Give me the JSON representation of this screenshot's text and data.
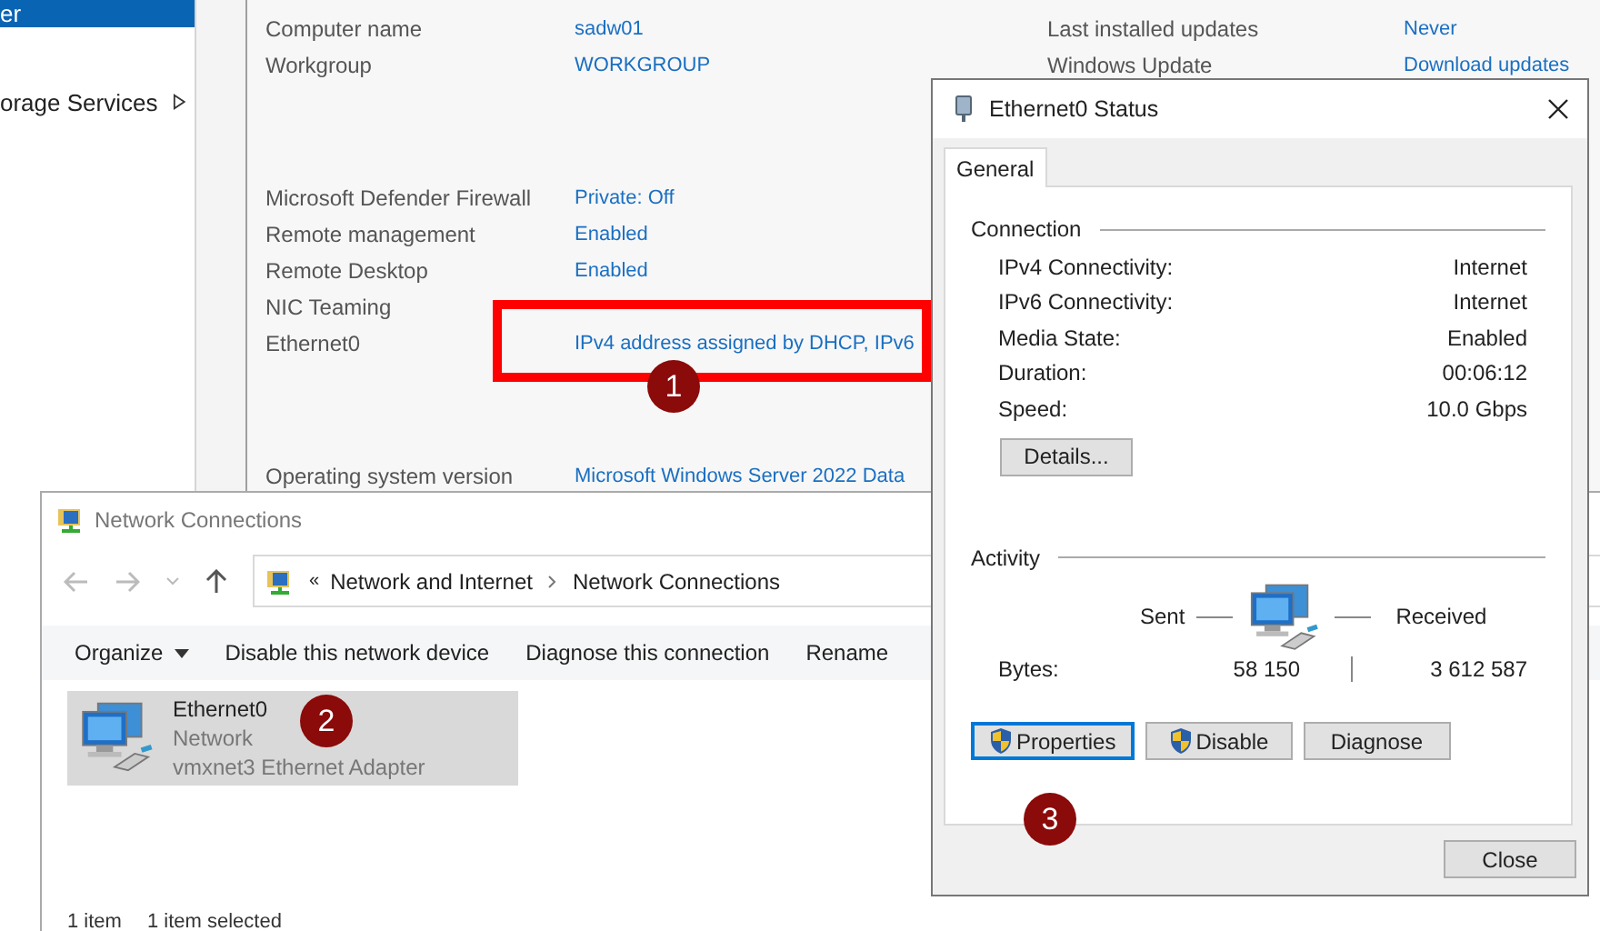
{
  "server_manager": {
    "sidebar": [
      {
        "label": "er",
        "selected": true,
        "submenu": false
      },
      {
        "label": "orage Services",
        "selected": false,
        "submenu": true
      }
    ],
    "left_groups": [
      [
        {
          "label": "Computer name",
          "value": "sadw01"
        },
        {
          "label": "Workgroup",
          "value": "WORKGROUP"
        }
      ],
      [
        {
          "label": "Microsoft Defender Firewall",
          "value": "Private: Off"
        },
        {
          "label": "Remote management",
          "value": "Enabled"
        },
        {
          "label": "Remote Desktop",
          "value": "Enabled"
        },
        {
          "label": "NIC Teaming"
        },
        {
          "label": "Ethernet0",
          "value": "IPv4 address assigned by DHCP, IPv6"
        }
      ],
      [
        {
          "label": "Operating system version",
          "value": "Microsoft Windows Server 2022 Data"
        }
      ]
    ],
    "right_groups": [
      [
        {
          "label": "Last installed updates",
          "value": "Never"
        },
        {
          "label": "Windows Update",
          "value": "Download updates"
        }
      ]
    ]
  },
  "network_connections": {
    "title": "Network Connections",
    "breadcrumb_overflow": "«",
    "breadcrumb": [
      "Network and Internet",
      "Network Connections"
    ],
    "commands": [
      {
        "label": "Organize",
        "dropdown": true
      },
      {
        "label": "Disable this network device",
        "dropdown": false
      },
      {
        "label": "Diagnose this connection",
        "dropdown": false
      },
      {
        "label": "Rename",
        "dropdown": false
      }
    ],
    "items": [
      {
        "name": "Ethernet0",
        "status": "Network",
        "device": "vmxnet3 Ethernet Adapter",
        "selected": true
      }
    ],
    "status_bar": [
      "1 item",
      "1 item selected"
    ]
  },
  "status_dialog": {
    "title": "Ethernet0 Status",
    "tabs": [
      {
        "label": "General",
        "selected": true
      }
    ],
    "connection_title": "Connection",
    "connection_rows": [
      {
        "label": "IPv4 Connectivity:",
        "value": "Internet"
      },
      {
        "label": "IPv6 Connectivity:",
        "value": "Internet"
      },
      {
        "label": "Media State:",
        "value": "Enabled"
      },
      {
        "label": "Duration:",
        "value": "00:06:12"
      },
      {
        "label": "Speed:",
        "value": "10.0 Gbps"
      }
    ],
    "details_button": "Details...",
    "activity_title": "Activity",
    "sent_label": "Sent",
    "received_label": "Received",
    "bytes_label": "Bytes:",
    "bytes_sent": "58 150",
    "bytes_received": "3 612 587",
    "buttons": [
      {
        "label": "Properties",
        "shield": true,
        "focused": true
      },
      {
        "label": "Disable",
        "shield": true,
        "focused": false
      },
      {
        "label": "Diagnose",
        "shield": false,
        "focused": false
      }
    ],
    "close_button": "Close"
  },
  "callouts": [
    "1",
    "2",
    "3"
  ]
}
